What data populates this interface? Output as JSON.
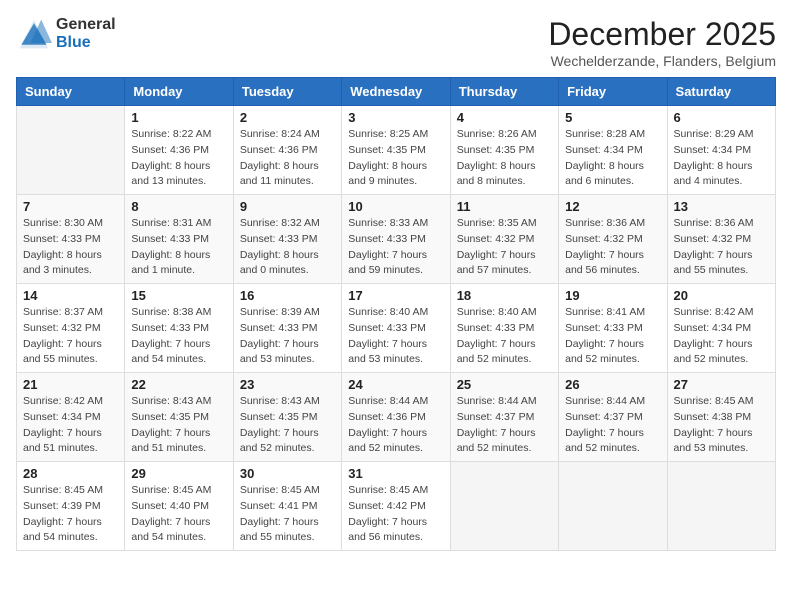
{
  "logo": {
    "general": "General",
    "blue": "Blue"
  },
  "title": "December 2025",
  "location": "Wechelderzande, Flanders, Belgium",
  "weekdays": [
    "Sunday",
    "Monday",
    "Tuesday",
    "Wednesday",
    "Thursday",
    "Friday",
    "Saturday"
  ],
  "weeks": [
    [
      {
        "day": "",
        "info": ""
      },
      {
        "day": "1",
        "info": "Sunrise: 8:22 AM\nSunset: 4:36 PM\nDaylight: 8 hours\nand 13 minutes."
      },
      {
        "day": "2",
        "info": "Sunrise: 8:24 AM\nSunset: 4:36 PM\nDaylight: 8 hours\nand 11 minutes."
      },
      {
        "day": "3",
        "info": "Sunrise: 8:25 AM\nSunset: 4:35 PM\nDaylight: 8 hours\nand 9 minutes."
      },
      {
        "day": "4",
        "info": "Sunrise: 8:26 AM\nSunset: 4:35 PM\nDaylight: 8 hours\nand 8 minutes."
      },
      {
        "day": "5",
        "info": "Sunrise: 8:28 AM\nSunset: 4:34 PM\nDaylight: 8 hours\nand 6 minutes."
      },
      {
        "day": "6",
        "info": "Sunrise: 8:29 AM\nSunset: 4:34 PM\nDaylight: 8 hours\nand 4 minutes."
      }
    ],
    [
      {
        "day": "7",
        "info": "Sunrise: 8:30 AM\nSunset: 4:33 PM\nDaylight: 8 hours\nand 3 minutes."
      },
      {
        "day": "8",
        "info": "Sunrise: 8:31 AM\nSunset: 4:33 PM\nDaylight: 8 hours\nand 1 minute."
      },
      {
        "day": "9",
        "info": "Sunrise: 8:32 AM\nSunset: 4:33 PM\nDaylight: 8 hours\nand 0 minutes."
      },
      {
        "day": "10",
        "info": "Sunrise: 8:33 AM\nSunset: 4:33 PM\nDaylight: 7 hours\nand 59 minutes."
      },
      {
        "day": "11",
        "info": "Sunrise: 8:35 AM\nSunset: 4:32 PM\nDaylight: 7 hours\nand 57 minutes."
      },
      {
        "day": "12",
        "info": "Sunrise: 8:36 AM\nSunset: 4:32 PM\nDaylight: 7 hours\nand 56 minutes."
      },
      {
        "day": "13",
        "info": "Sunrise: 8:36 AM\nSunset: 4:32 PM\nDaylight: 7 hours\nand 55 minutes."
      }
    ],
    [
      {
        "day": "14",
        "info": "Sunrise: 8:37 AM\nSunset: 4:32 PM\nDaylight: 7 hours\nand 55 minutes."
      },
      {
        "day": "15",
        "info": "Sunrise: 8:38 AM\nSunset: 4:33 PM\nDaylight: 7 hours\nand 54 minutes."
      },
      {
        "day": "16",
        "info": "Sunrise: 8:39 AM\nSunset: 4:33 PM\nDaylight: 7 hours\nand 53 minutes."
      },
      {
        "day": "17",
        "info": "Sunrise: 8:40 AM\nSunset: 4:33 PM\nDaylight: 7 hours\nand 53 minutes."
      },
      {
        "day": "18",
        "info": "Sunrise: 8:40 AM\nSunset: 4:33 PM\nDaylight: 7 hours\nand 52 minutes."
      },
      {
        "day": "19",
        "info": "Sunrise: 8:41 AM\nSunset: 4:33 PM\nDaylight: 7 hours\nand 52 minutes."
      },
      {
        "day": "20",
        "info": "Sunrise: 8:42 AM\nSunset: 4:34 PM\nDaylight: 7 hours\nand 52 minutes."
      }
    ],
    [
      {
        "day": "21",
        "info": "Sunrise: 8:42 AM\nSunset: 4:34 PM\nDaylight: 7 hours\nand 51 minutes."
      },
      {
        "day": "22",
        "info": "Sunrise: 8:43 AM\nSunset: 4:35 PM\nDaylight: 7 hours\nand 51 minutes."
      },
      {
        "day": "23",
        "info": "Sunrise: 8:43 AM\nSunset: 4:35 PM\nDaylight: 7 hours\nand 52 minutes."
      },
      {
        "day": "24",
        "info": "Sunrise: 8:44 AM\nSunset: 4:36 PM\nDaylight: 7 hours\nand 52 minutes."
      },
      {
        "day": "25",
        "info": "Sunrise: 8:44 AM\nSunset: 4:37 PM\nDaylight: 7 hours\nand 52 minutes."
      },
      {
        "day": "26",
        "info": "Sunrise: 8:44 AM\nSunset: 4:37 PM\nDaylight: 7 hours\nand 52 minutes."
      },
      {
        "day": "27",
        "info": "Sunrise: 8:45 AM\nSunset: 4:38 PM\nDaylight: 7 hours\nand 53 minutes."
      }
    ],
    [
      {
        "day": "28",
        "info": "Sunrise: 8:45 AM\nSunset: 4:39 PM\nDaylight: 7 hours\nand 54 minutes."
      },
      {
        "day": "29",
        "info": "Sunrise: 8:45 AM\nSunset: 4:40 PM\nDaylight: 7 hours\nand 54 minutes."
      },
      {
        "day": "30",
        "info": "Sunrise: 8:45 AM\nSunset: 4:41 PM\nDaylight: 7 hours\nand 55 minutes."
      },
      {
        "day": "31",
        "info": "Sunrise: 8:45 AM\nSunset: 4:42 PM\nDaylight: 7 hours\nand 56 minutes."
      },
      {
        "day": "",
        "info": ""
      },
      {
        "day": "",
        "info": ""
      },
      {
        "day": "",
        "info": ""
      }
    ]
  ]
}
